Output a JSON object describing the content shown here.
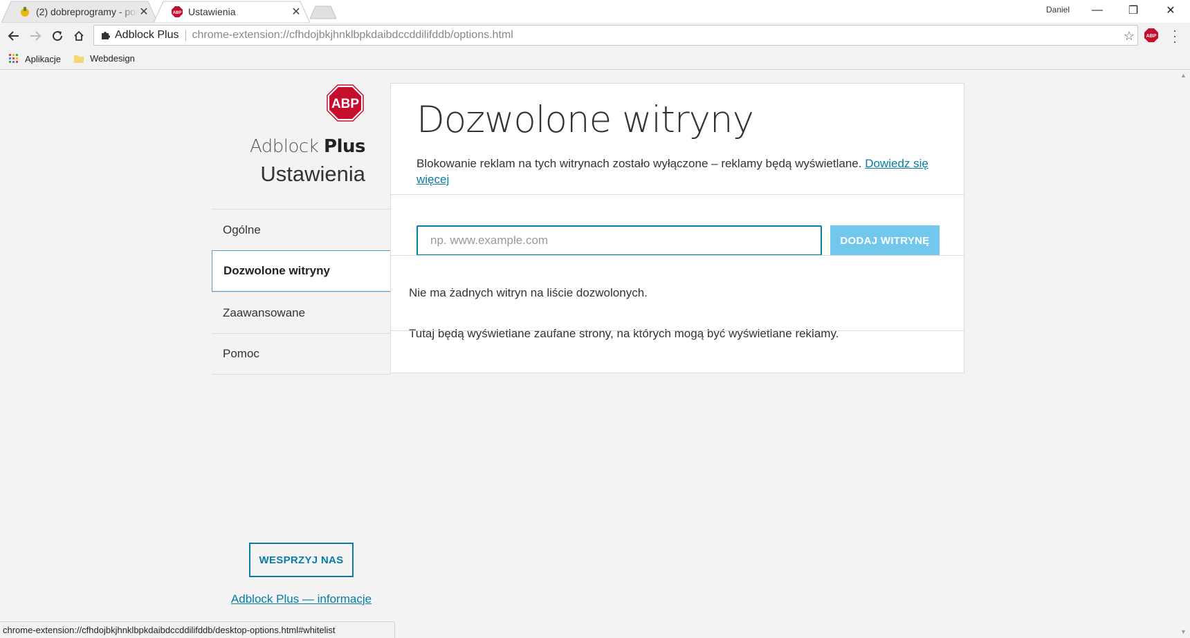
{
  "browser": {
    "tabs": [
      {
        "title": "(2) dobreprogramy - por",
        "icon": "dobreprogramy-favicon"
      },
      {
        "title": "Ustawienia",
        "icon": "abp-favicon"
      }
    ],
    "user": "Daniel",
    "omnibox": {
      "origin": "Adblock Plus",
      "url": "chrome-extension://cfhdojbkjhnklbpkdaibdccddilifddb/options.html"
    },
    "bookmarks": [
      {
        "label": "Aplikacje",
        "icon": "apps-grid-icon"
      },
      {
        "label": "Webdesign",
        "icon": "folder-icon"
      }
    ],
    "status_url": "chrome-extension://cfhdojbkjhnklbpkdaibdccddilifddb/desktop-options.html#whitelist"
  },
  "sidebar": {
    "brand_light": "Adblock",
    "brand_bold": "Plus",
    "subtitle": "Ustawienia",
    "items": [
      {
        "label": "Ogólne",
        "active": false
      },
      {
        "label": "Dozwolone witryny",
        "active": true
      },
      {
        "label": "Zaawansowane",
        "active": false
      },
      {
        "label": "Pomoc",
        "active": false
      }
    ],
    "support_label": "WESPRZYJ NAS",
    "about_label": "Adblock Plus — informacje"
  },
  "main": {
    "title": "Dozwolone witryny",
    "description": "Blokowanie reklam na tych witrynach zostało wyłączone – reklamy będą wyświetlane.",
    "learn_more": "Dowiedz się więcej",
    "input_placeholder": "np. www.example.com",
    "add_label": "DODAJ WITRYNĘ",
    "empty_title": "Nie ma żadnych witryn na liście dozwolonych.",
    "empty_hint": "Tutaj będą wyświetlane zaufane strony, na których mogą być wyświetlane reklamy."
  },
  "colors": {
    "accent": "#077ca6",
    "add_button": "#72c7ec",
    "abp_red": "#c70d2c"
  }
}
